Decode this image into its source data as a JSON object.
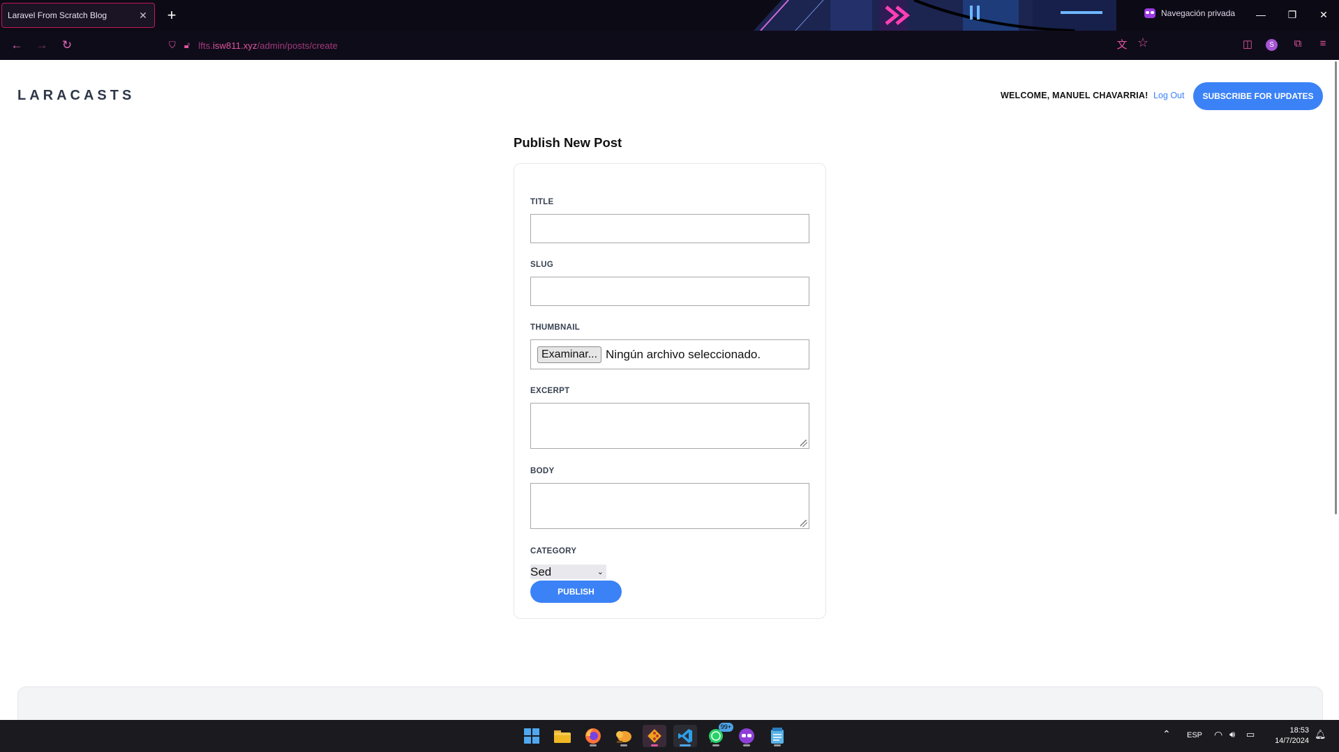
{
  "browser": {
    "tab_title": "Laravel From Scratch Blog",
    "tab_close": "✕",
    "new_tab": "+",
    "private_label": "Navegación privada",
    "url_prefix": "lfts.",
    "url_host": "isw811.xyz",
    "url_path": "/admin/posts/create",
    "profile_initial": "S"
  },
  "header": {
    "logo": "LARACASTS",
    "welcome": "WELCOME, MANUEL CHAVARRIA!",
    "logout": "Log Out",
    "subscribe": "SUBSCRIBE FOR UPDATES"
  },
  "form": {
    "page_title": "Publish New Post",
    "title_label": "TITLE",
    "slug_label": "SLUG",
    "thumbnail_label": "THUMBNAIL",
    "file_button": "Examinar...",
    "file_status": "Ningún archivo seleccionado.",
    "excerpt_label": "EXCERPT",
    "body_label": "BODY",
    "category_label": "CATEGORY",
    "category_value": "Sed",
    "publish_button": "PUBLISH"
  },
  "taskbar": {
    "whatsapp_badge": "99+",
    "language": "ESP",
    "time": "18:53",
    "date": "14/7/2024"
  },
  "colors": {
    "accent": "#3b82f6",
    "browser_accent": "#e0559f"
  }
}
